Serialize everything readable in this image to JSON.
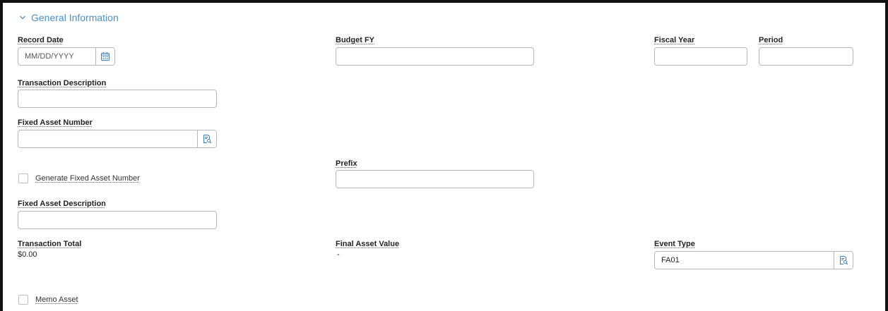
{
  "section": {
    "title": "General Information",
    "icon": "chevron-down-icon"
  },
  "fields": {
    "record_date": {
      "label": "Record Date",
      "value": "",
      "placeholder": "MM/DD/YYYY",
      "icon": "calendar-icon"
    },
    "budget_fy": {
      "label": "Budget FY",
      "value": ""
    },
    "fiscal_year": {
      "label": "Fiscal Year",
      "value": ""
    },
    "period": {
      "label": "Period",
      "value": ""
    },
    "transaction_description": {
      "label": "Transaction Description",
      "value": ""
    },
    "fixed_asset_number": {
      "label": "Fixed Asset Number",
      "value": "",
      "icon": "lookup-icon"
    },
    "generate_fixed_asset_number": {
      "label": "Generate Fixed Asset Number",
      "checked": false
    },
    "prefix": {
      "label": "Prefix",
      "value": ""
    },
    "fixed_asset_description": {
      "label": "Fixed Asset Description",
      "value": ""
    },
    "transaction_total": {
      "label": "Transaction Total",
      "value": "$0.00"
    },
    "final_asset_value": {
      "label": "Final Asset Value",
      "value": "-"
    },
    "event_type": {
      "label": "Event Type",
      "value": "FA01",
      "icon": "lookup-icon"
    },
    "memo_asset": {
      "label": "Memo Asset",
      "checked": false
    }
  },
  "colors": {
    "accent": "#4a90c2",
    "border": "#b8b8b8",
    "icon": "#3a7fb8"
  }
}
